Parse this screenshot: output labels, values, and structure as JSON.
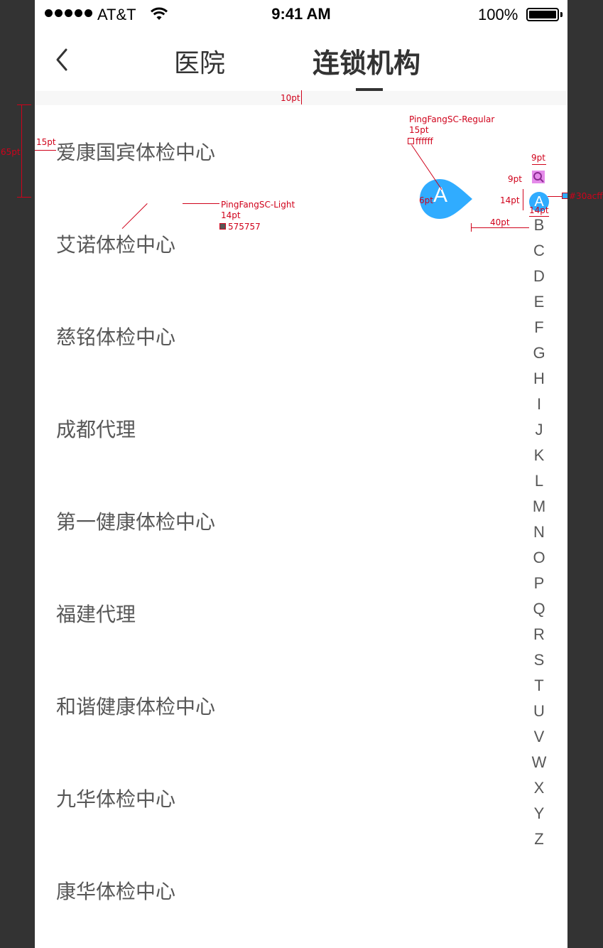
{
  "status_bar": {
    "carrier": "AT&T",
    "time": "9:41 AM",
    "battery": "100%"
  },
  "nav": {
    "tabs": [
      {
        "label": "医院",
        "active": false
      },
      {
        "label": "连锁机构",
        "active": true
      }
    ]
  },
  "list": {
    "items": [
      "爱康国宾体检中心",
      "艾诺体检中心",
      "慈铭体检中心",
      "成都代理",
      "第一健康体检中心",
      "福建代理",
      "和谐健康体检中心",
      "九华体检中心",
      "康华体检中心"
    ],
    "text_color": "#575757"
  },
  "index_bar": {
    "active_letter": "A",
    "bubble_letter": "A",
    "letters": [
      "B",
      "C",
      "D",
      "E",
      "F",
      "G",
      "H",
      "I",
      "J",
      "K",
      "L",
      "M",
      "N",
      "O",
      "P",
      "Q",
      "R",
      "S",
      "T",
      "U",
      "V",
      "W",
      "X",
      "Y",
      "Z"
    ],
    "accent_color": "#30acff"
  },
  "annotations": {
    "divider_height": "10pt",
    "row_height": "65pt",
    "left_padding": "15pt",
    "item_font": "PingFangSC-Light",
    "item_size": "14pt",
    "item_color": "575757",
    "bubble_font": "PingFangSC-Regular",
    "bubble_size": "15pt",
    "bubble_color": "ffffff",
    "bubble_offset": "6pt",
    "search_width": "9pt",
    "search_height": "9pt",
    "circle_height": "14pt",
    "circle_width": "14pt",
    "bubble_gap": "40pt",
    "accent_label": "#30acff"
  }
}
